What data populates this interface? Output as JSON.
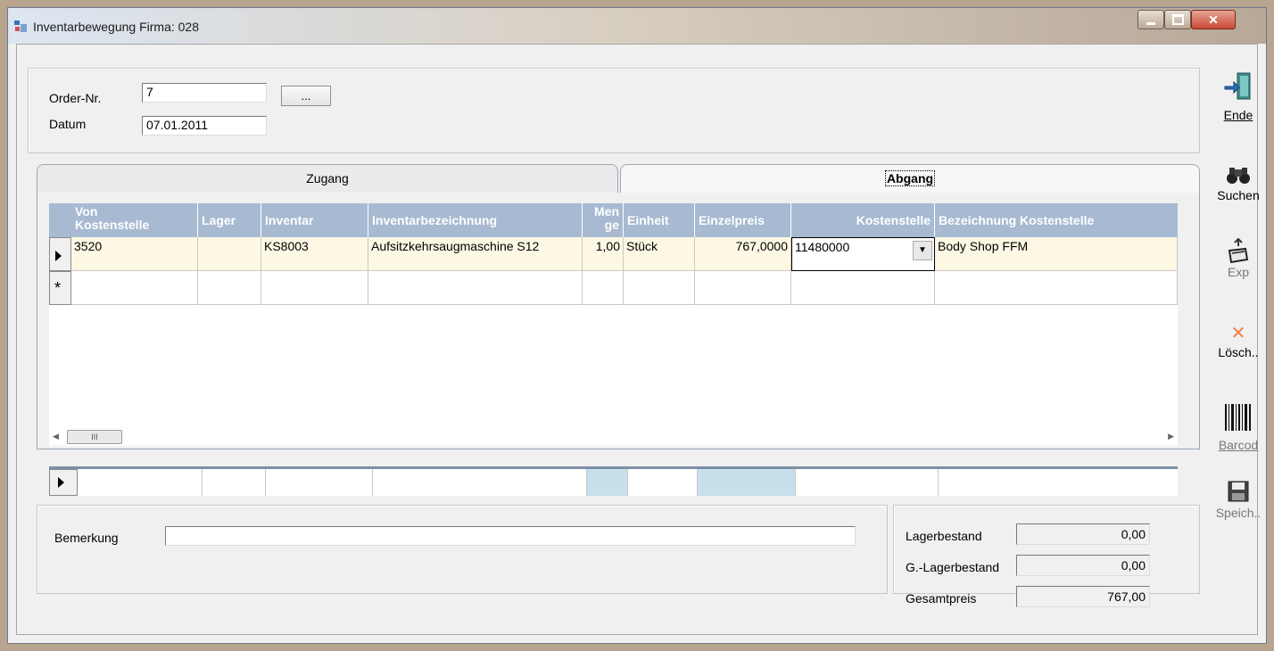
{
  "window": {
    "title": "Inventarbewegung Firma: 028"
  },
  "header": {
    "order_label": "Order-Nr.",
    "order_value": "7",
    "browse_label": "...",
    "date_label": "Datum",
    "date_value": "07.01.2011"
  },
  "tabs": [
    {
      "label": "Zugang"
    },
    {
      "label": "Abgang"
    }
  ],
  "grid": {
    "columns": [
      "Von\nKostenstelle",
      "Lager",
      "Inventar",
      "Inventarbezeichnung",
      "Men\nge",
      "Einheit",
      "Einzelpreis",
      "Kostenstelle",
      "Bezeichnung Kostenstelle"
    ],
    "rows": [
      {
        "von_kostenstelle": "3520",
        "lager": "",
        "inventar": "KS8003",
        "bezeichnung": "Aufsitzkehrsaugmaschine S12",
        "menge": "1,00",
        "einheit": "Stück",
        "einzelpreis": "767,0000",
        "kostenstelle": "11480000",
        "bezeichnung_kostenstelle": "Body Shop FFM"
      }
    ],
    "scroll_thumb": "III"
  },
  "bemerkung": {
    "label": "Bemerkung",
    "value": ""
  },
  "summary": {
    "lagerbestand_label": "Lagerbestand",
    "lagerbestand": "0,00",
    "g_lagerbestand_label": "G.-Lagerbestand",
    "g_lagerbestand": "0,00",
    "gesamtpreis_label": "Gesamtpreis",
    "gesamtpreis": "767,00"
  },
  "sidebar": [
    {
      "label": "Ende",
      "icon": "exit-door-icon"
    },
    {
      "label": "Suchen",
      "icon": "binoculars-icon"
    },
    {
      "label": "Exp",
      "icon": "export-icon"
    },
    {
      "label": "Lösch..",
      "icon": "delete-x-icon"
    },
    {
      "label": "Barcod",
      "icon": "barcode-icon"
    },
    {
      "label": "Speich..",
      "icon": "save-disk-icon"
    }
  ]
}
